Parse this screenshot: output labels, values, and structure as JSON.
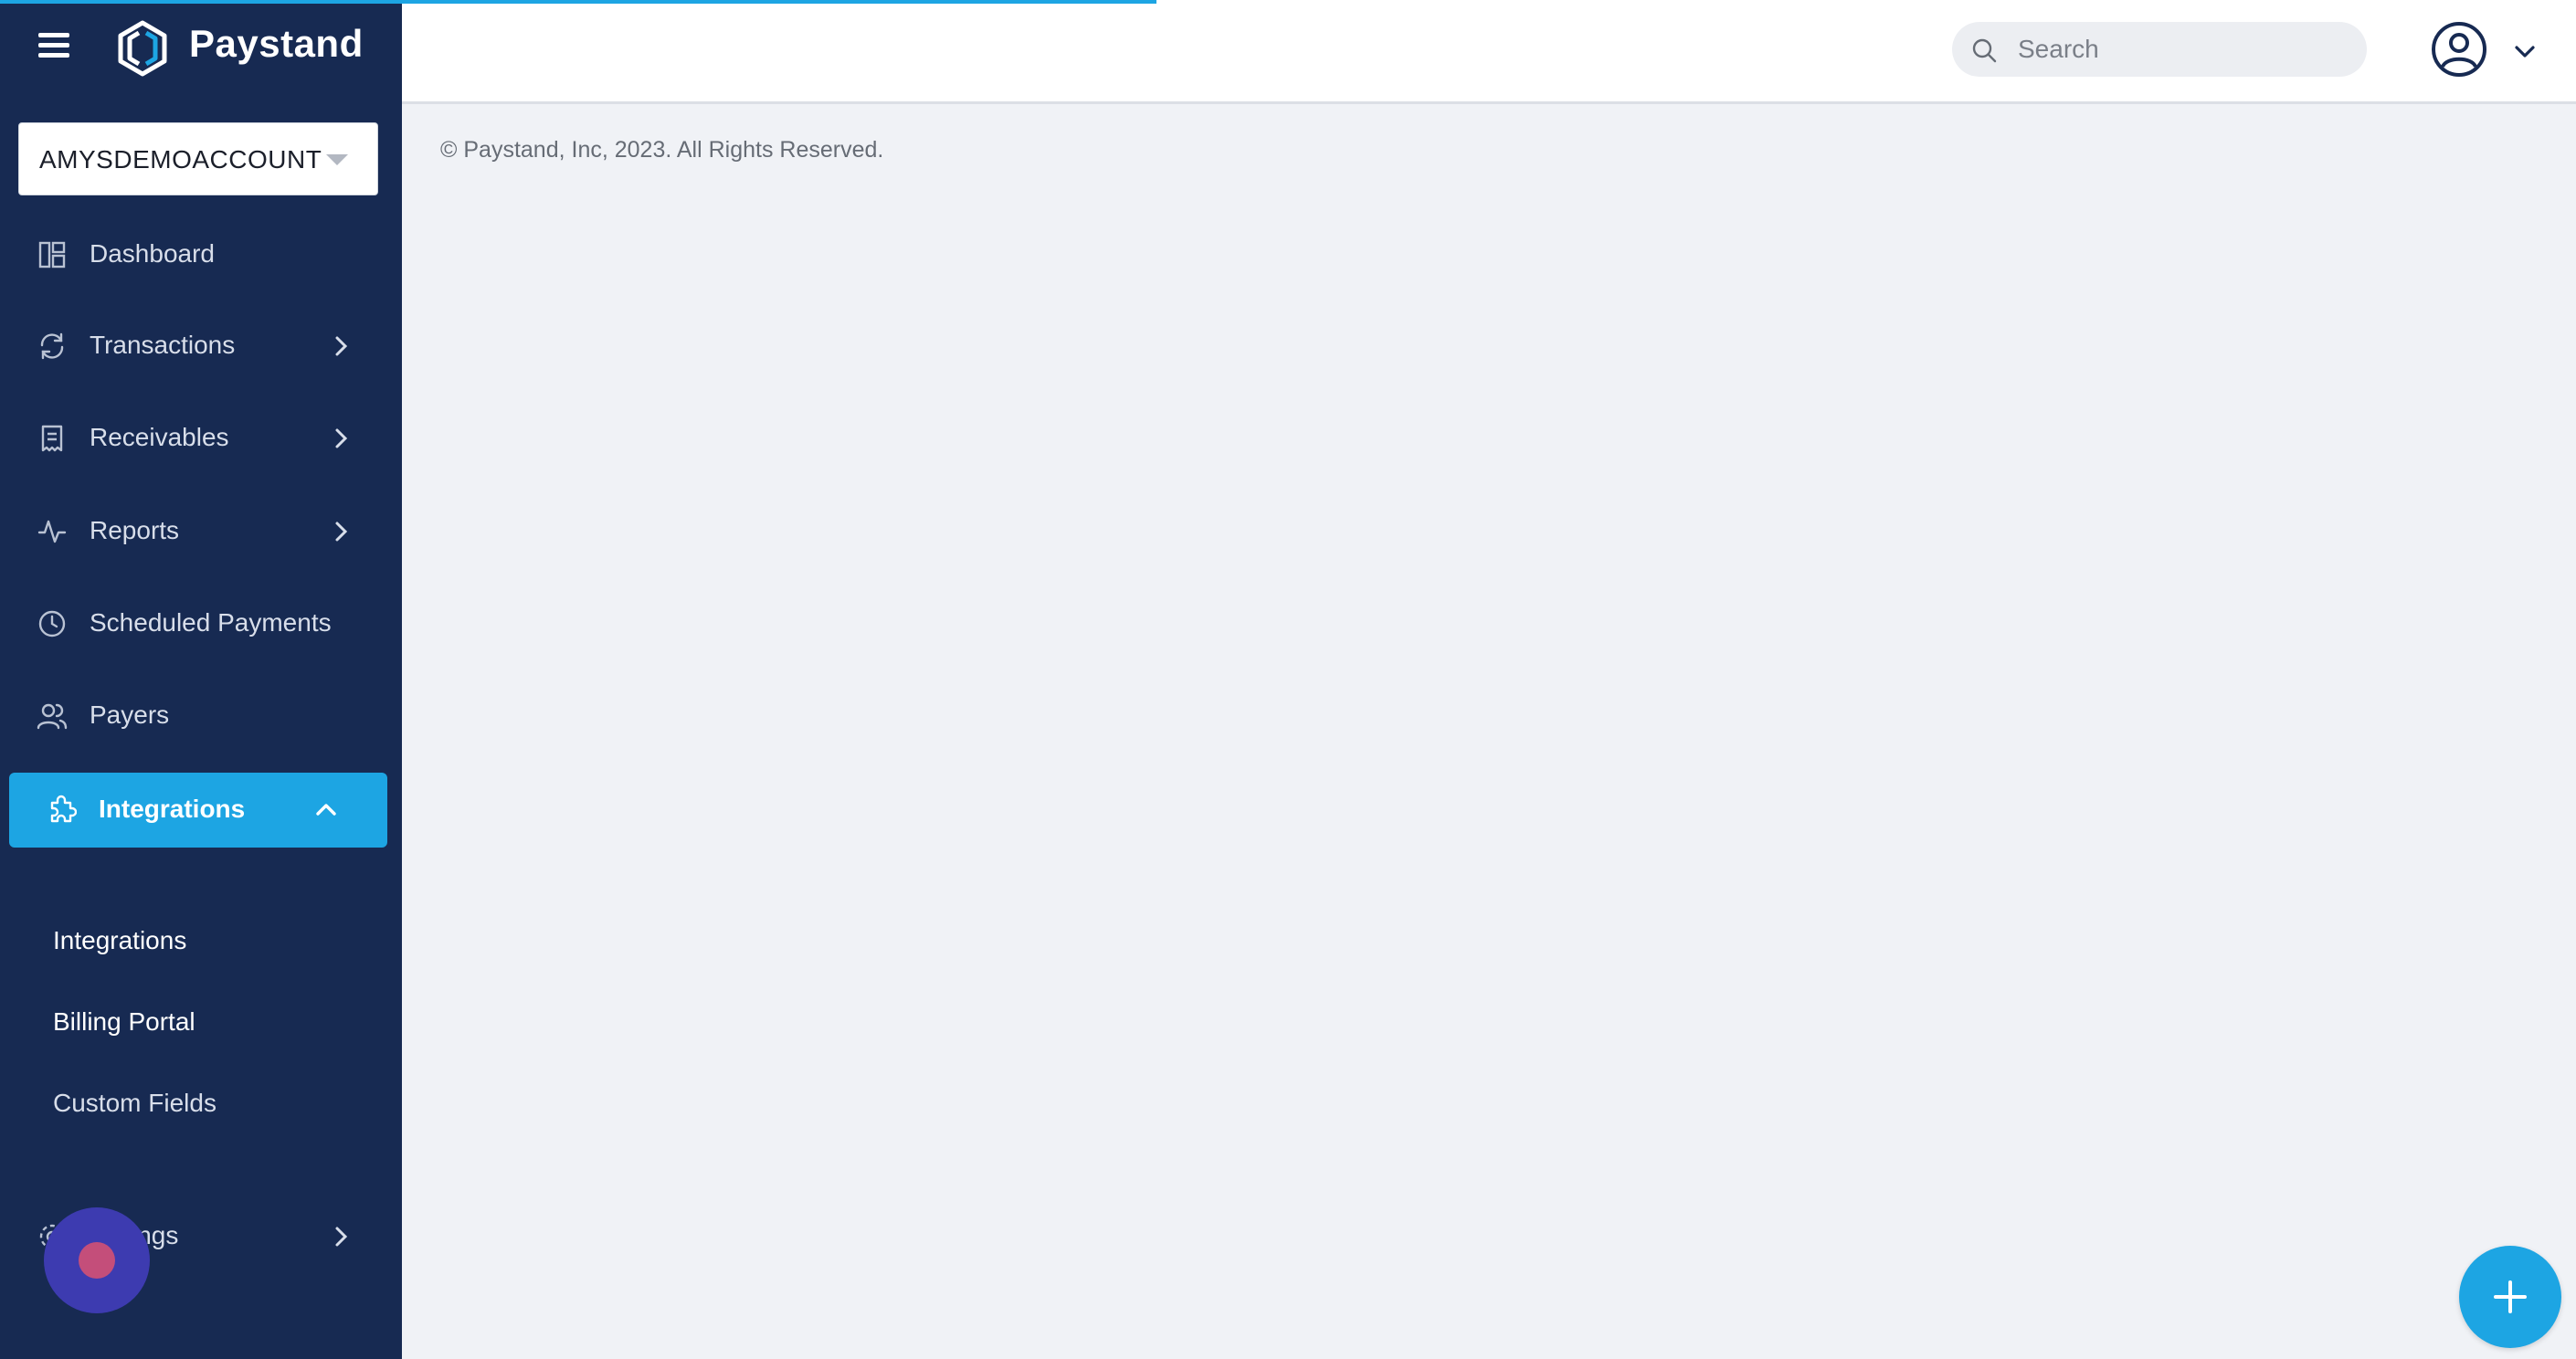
{
  "app": {
    "name": "Paystand"
  },
  "account": {
    "selected": "AMYSDEMOACCOUNT"
  },
  "sidebar": {
    "items": [
      {
        "label": "Dashboard",
        "icon": "dashboard-icon",
        "has_children": false
      },
      {
        "label": "Transactions",
        "icon": "refresh-icon",
        "has_children": true
      },
      {
        "label": "Receivables",
        "icon": "receipt-icon",
        "has_children": true
      },
      {
        "label": "Reports",
        "icon": "activity-icon",
        "has_children": true
      },
      {
        "label": "Scheduled Payments",
        "icon": "clock-icon",
        "has_children": false
      },
      {
        "label": "Payers",
        "icon": "users-icon",
        "has_children": false
      },
      {
        "label": "Integrations",
        "icon": "puzzle-icon",
        "has_children": true,
        "active": true,
        "expanded": true
      },
      {
        "label": "ings",
        "icon": "gear-icon",
        "has_children": true
      }
    ],
    "subitems": [
      {
        "label": "Integrations"
      },
      {
        "label": "Billing Portal"
      },
      {
        "label": "Custom Fields"
      }
    ]
  },
  "search": {
    "placeholder": "Search"
  },
  "footer": {
    "copyright": "© Paystand, Inc, 2023. All Rights Reserved."
  },
  "colors": {
    "sidebar": "#172a52",
    "accent": "#1da5e3",
    "background": "#f0f2f6"
  }
}
